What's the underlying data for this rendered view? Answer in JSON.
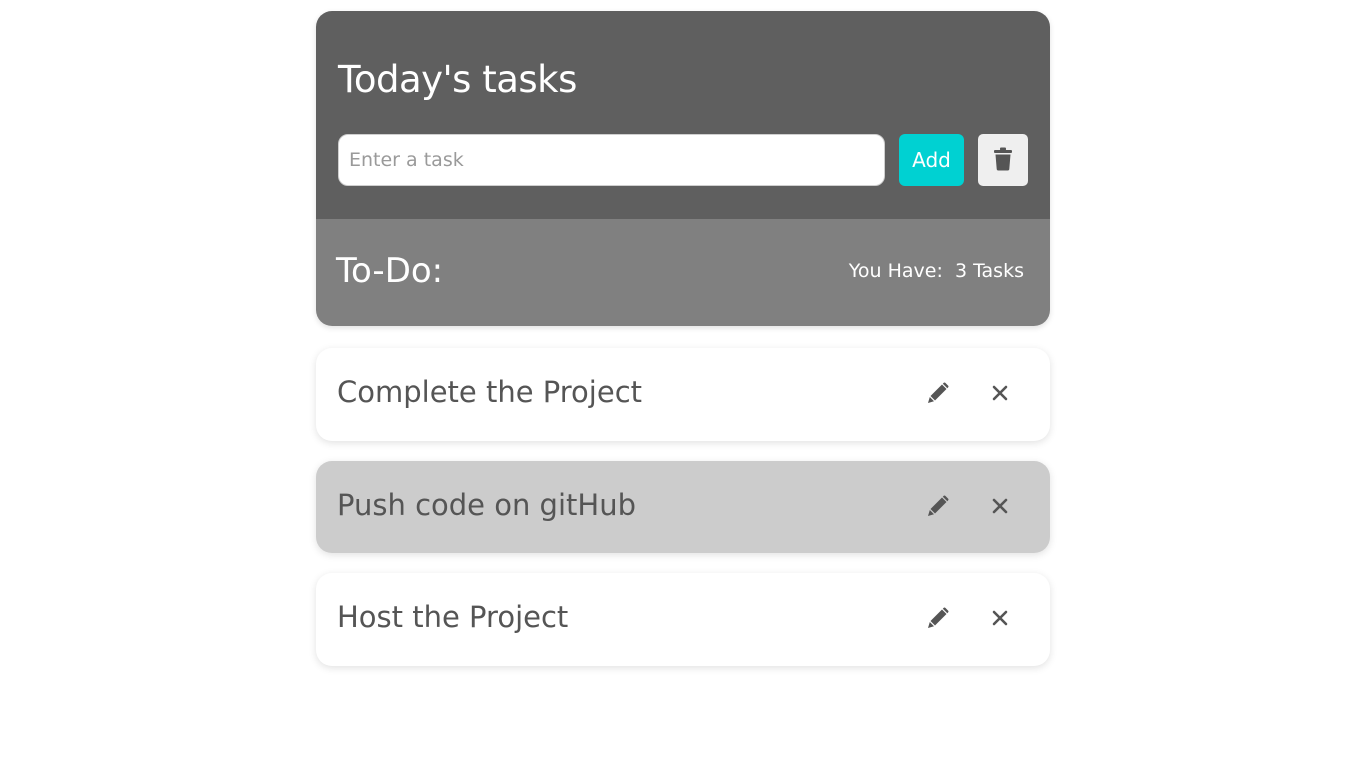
{
  "header": {
    "title": "Today's tasks",
    "input_placeholder": "Enter a task",
    "input_value": "",
    "add_label": "Add",
    "clear_icon": "trash-icon"
  },
  "summary": {
    "label": "To-Do:",
    "count_prefix": "You Have:",
    "count_value": "3 Tasks"
  },
  "tasks": [
    {
      "text": "Complete the Project",
      "highlighted": false,
      "edit_icon": "pencil-icon",
      "delete_icon": "close-icon"
    },
    {
      "text": "Push code on gitHub",
      "highlighted": true,
      "edit_icon": "pencil-icon",
      "delete_icon": "close-icon"
    },
    {
      "text": "Host the Project",
      "highlighted": false,
      "edit_icon": "pencil-icon",
      "delete_icon": "close-icon"
    }
  ],
  "colors": {
    "header_top": "#5f5f5f",
    "header_bottom": "#808080",
    "accent": "#00d1d2",
    "highlighted_task": "#cccccc",
    "task_text": "#555555"
  }
}
